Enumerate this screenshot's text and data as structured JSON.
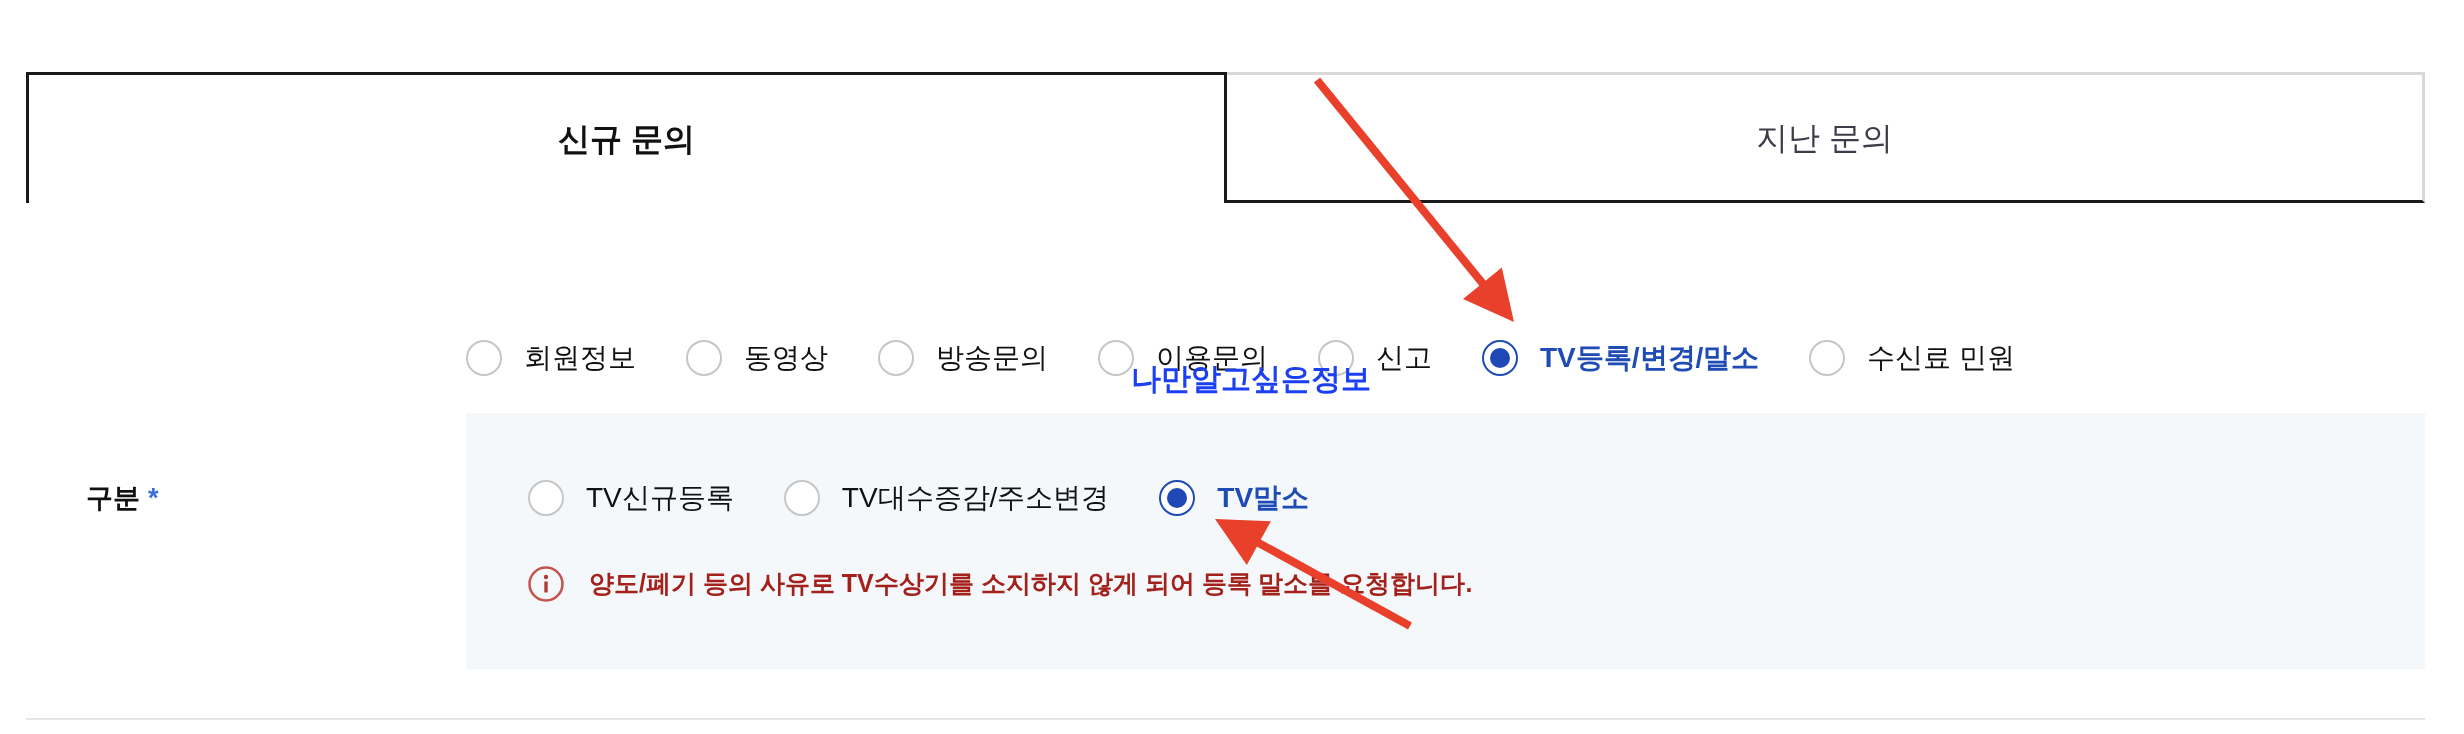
{
  "tabs": [
    {
      "label": "신규 문의",
      "selected": true
    },
    {
      "label": "지난 문의",
      "selected": false
    }
  ],
  "inquiry_type": {
    "options": [
      {
        "label": "회원정보",
        "selected": false
      },
      {
        "label": "동영상",
        "selected": false
      },
      {
        "label": "방송문의",
        "selected": false
      },
      {
        "label": "이용문의",
        "selected": false
      },
      {
        "label": "신고",
        "selected": false
      },
      {
        "label": "TV등록/변경/말소",
        "selected": true
      },
      {
        "label": "수신료 민원",
        "selected": false
      }
    ]
  },
  "overlay_note": "나만알고싶은정보",
  "category_field": {
    "label": "구분",
    "required_mark": "*",
    "options": [
      {
        "label": "TV신규등록",
        "selected": false
      },
      {
        "label": "TV대수증감/주소변경",
        "selected": false
      },
      {
        "label": "TV말소",
        "selected": true
      }
    ],
    "notice": "양도/폐기 등의 사유로 TV수상기를 소지하지 않게 되어 등록 말소를 요청합니다."
  }
}
